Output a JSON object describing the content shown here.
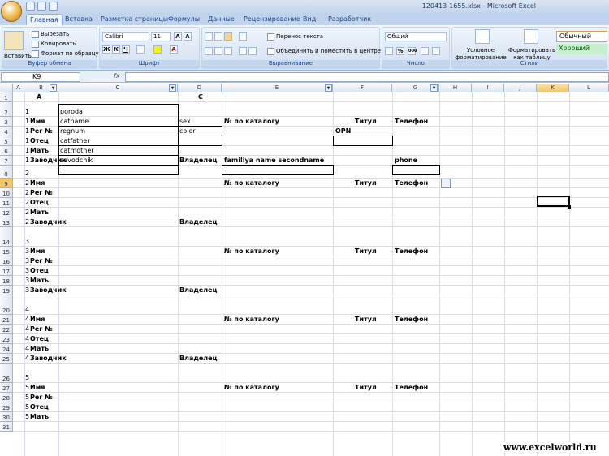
{
  "window": {
    "title": "120413-1655.xlsx - Microsoft Excel"
  },
  "ribbon_tabs": [
    "Главная",
    "Вставка",
    "Разметка страницы",
    "Формулы",
    "Данные",
    "Рецензирование",
    "Вид",
    "Разработчик"
  ],
  "clipboard": {
    "paste": "Вставить",
    "cut": "Вырезать",
    "copy": "Копировать",
    "format_painter": "Формат по образцу",
    "label": "Буфер обмена"
  },
  "font": {
    "name": "Calibri",
    "size": "11",
    "label": "Шрифт"
  },
  "alignment": {
    "wrap": "Перенос текста",
    "merge": "Объединить и поместить в центре",
    "label": "Выравнивание"
  },
  "number": {
    "format": "Общий",
    "label": "Число"
  },
  "styles": {
    "conditional": "Условное форматирование",
    "as_table": "Форматировать как таблицу",
    "normal": "Обычный",
    "good": "Хороший",
    "label": "Стили"
  },
  "formula_bar": {
    "name_box": "K9",
    "fx": "fx",
    "value": ""
  },
  "columns": [
    "A",
    "B",
    "C",
    "D",
    "E",
    "F",
    "G",
    "H",
    "I",
    "J",
    "K",
    "L"
  ],
  "selected_column": "K",
  "row_numbers": [
    "1",
    "2",
    "3",
    "4",
    "5",
    "6",
    "7",
    "8",
    "9",
    "10",
    "11",
    "12",
    "13",
    "14",
    "15",
    "16",
    "17",
    "18",
    "19",
    "20",
    "21",
    "22",
    "23",
    "24",
    "25",
    "26",
    "27",
    "28",
    "29",
    "30",
    "31"
  ],
  "selected_row": "9",
  "cells": {
    "header_A": "A",
    "header_C": "C",
    "r2_B": "1",
    "r2_C": "poroda",
    "r3_B": "1",
    "r3_Bl": "Имя",
    "r3_C": "catname",
    "r3_D": "sex",
    "r3_E": "№ по каталогу",
    "r3_F": "Титул",
    "r3_G": "Телефон",
    "r4_B": "1",
    "r4_Bl": "Рег №",
    "r4_C": "regnum",
    "r4_D": "color",
    "r4_F": "OPN",
    "r5_B": "1",
    "r5_Bl": "Отец",
    "r5_C": "catfather",
    "r6_B": "1",
    "r6_Bl": "Мать",
    "r6_C": "catmother",
    "r7_B": "1",
    "r7_Bl": "Заводчик",
    "r7_C": "zavodchik",
    "r7_D": "Владелец",
    "r7_E": "familiya name secondname",
    "r7_G": "phone",
    "r8_B": "2",
    "r9_B": "2",
    "r9_Bl": "Имя",
    "r9_E": "№ по каталогу",
    "r9_F": "Титул",
    "r9_G": "Телефон",
    "r10_B": "2",
    "r10_Bl": "Рег №",
    "r11_B": "2",
    "r11_Bl": "Отец",
    "r12_B": "2",
    "r12_Bl": "Мать",
    "r13_B": "2",
    "r13_Bl": "Заводчик",
    "r13_D": "Владелец",
    "r14_B": "3",
    "r15_B": "3",
    "r15_Bl": "Имя",
    "r15_E": "№ по каталогу",
    "r15_F": "Титул",
    "r15_G": "Телефон",
    "r16_B": "3",
    "r16_Bl": "Рег №",
    "r17_B": "3",
    "r17_Bl": "Отец",
    "r18_B": "3",
    "r18_Bl": "Мать",
    "r19_B": "3",
    "r19_Bl": "Заводчик",
    "r19_D": "Владелец",
    "r20_B": "4",
    "r21_B": "4",
    "r21_Bl": "Имя",
    "r21_E": "№ по каталогу",
    "r21_F": "Титул",
    "r21_G": "Телефон",
    "r22_B": "4",
    "r22_Bl": "Рег №",
    "r23_B": "4",
    "r23_Bl": "Отец",
    "r24_B": "4",
    "r24_Bl": "Мать",
    "r25_B": "4",
    "r25_Bl": "Заводчик",
    "r25_D": "Владелец",
    "r26_B": "5",
    "r27_B": "5",
    "r27_Bl": "Имя",
    "r27_E": "№ по каталогу",
    "r27_F": "Титул",
    "r27_G": "Телефон",
    "r28_B": "5",
    "r28_Bl": "Рег №",
    "r29_B": "5",
    "r29_Bl": "Отец",
    "r30_B": "5",
    "r30_Bl": "Мать"
  },
  "watermark": "www.excelworld.ru"
}
